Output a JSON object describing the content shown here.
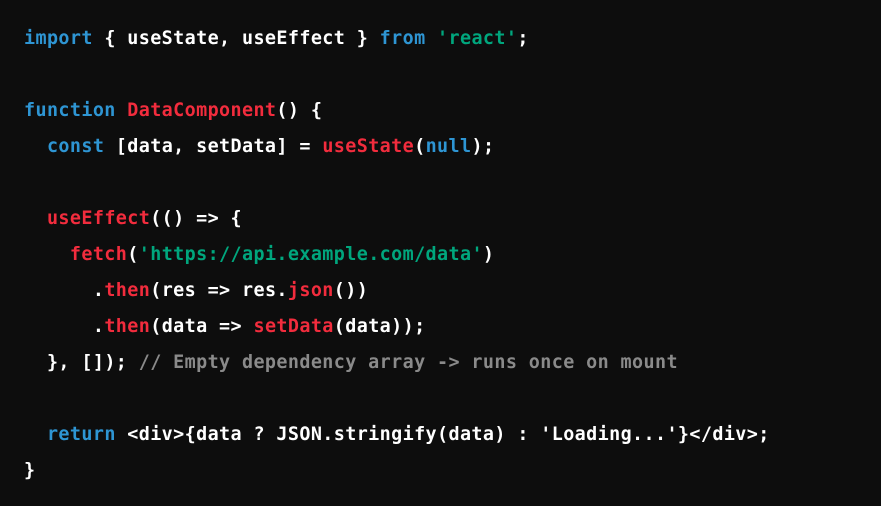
{
  "code": {
    "language": "jsx",
    "colors": {
      "background": "#0d0d0d",
      "keyword": "#2e95d3",
      "function": "#f22c3d",
      "string": "#00a67d",
      "comment": "#8a8a8a",
      "plain": "#ffffff"
    },
    "lines": [
      {
        "indent": "",
        "tokens": [
          {
            "t": "kw",
            "v": "import"
          },
          {
            "t": "pl",
            "v": " { useState, useEffect } "
          },
          {
            "t": "kw",
            "v": "from"
          },
          {
            "t": "pl",
            "v": " "
          },
          {
            "t": "str",
            "v": "'react'"
          },
          {
            "t": "pl",
            "v": ";"
          }
        ]
      },
      {
        "indent": "",
        "tokens": []
      },
      {
        "indent": "",
        "tokens": [
          {
            "t": "kw",
            "v": "function"
          },
          {
            "t": "pl",
            "v": " "
          },
          {
            "t": "fn",
            "v": "DataComponent"
          },
          {
            "t": "pl",
            "v": "() {"
          }
        ]
      },
      {
        "indent": "  ",
        "tokens": [
          {
            "t": "kw",
            "v": "const"
          },
          {
            "t": "pl",
            "v": " [data, setData] = "
          },
          {
            "t": "fn",
            "v": "useState"
          },
          {
            "t": "pl",
            "v": "("
          },
          {
            "t": "kw",
            "v": "null"
          },
          {
            "t": "pl",
            "v": ");"
          }
        ]
      },
      {
        "indent": "",
        "tokens": []
      },
      {
        "indent": "  ",
        "tokens": [
          {
            "t": "fn",
            "v": "useEffect"
          },
          {
            "t": "pl",
            "v": "(() => {"
          }
        ]
      },
      {
        "indent": "    ",
        "tokens": [
          {
            "t": "fn",
            "v": "fetch"
          },
          {
            "t": "pl",
            "v": "("
          },
          {
            "t": "str",
            "v": "'https://api.example.com/data'"
          },
          {
            "t": "pl",
            "v": ")"
          }
        ]
      },
      {
        "indent": "      ",
        "tokens": [
          {
            "t": "pl",
            "v": "."
          },
          {
            "t": "fn",
            "v": "then"
          },
          {
            "t": "pl",
            "v": "(res => res."
          },
          {
            "t": "fn",
            "v": "json"
          },
          {
            "t": "pl",
            "v": "())"
          }
        ]
      },
      {
        "indent": "      ",
        "tokens": [
          {
            "t": "pl",
            "v": "."
          },
          {
            "t": "fn",
            "v": "then"
          },
          {
            "t": "pl",
            "v": "(data => "
          },
          {
            "t": "fn",
            "v": "setData"
          },
          {
            "t": "pl",
            "v": "(data));"
          }
        ]
      },
      {
        "indent": "  ",
        "tokens": [
          {
            "t": "pl",
            "v": "}, []); "
          },
          {
            "t": "cm",
            "v": "// Empty dependency array -> runs once on mount"
          }
        ]
      },
      {
        "indent": "",
        "tokens": []
      },
      {
        "indent": "  ",
        "tokens": [
          {
            "t": "kw",
            "v": "return"
          },
          {
            "t": "pl",
            "v": " <div>{data ? JSON.stringify(data) : 'Loading...'}</div>;"
          }
        ]
      },
      {
        "indent": "",
        "tokens": [
          {
            "t": "pl",
            "v": "}"
          }
        ]
      }
    ]
  }
}
